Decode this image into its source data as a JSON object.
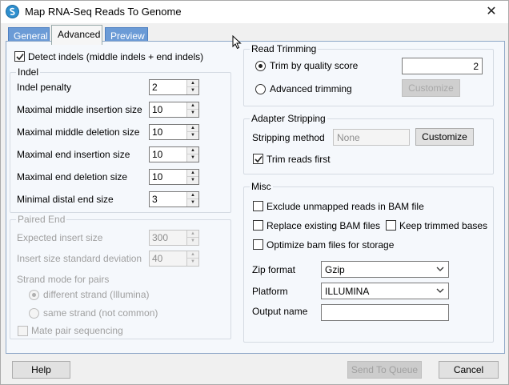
{
  "window": {
    "title": "Map RNA-Seq Reads To Genome",
    "close_symbol": "✕"
  },
  "tabs": [
    {
      "label": "General"
    },
    {
      "label": "Advanced"
    },
    {
      "label": "Preview"
    }
  ],
  "left": {
    "detect_indels": {
      "label": "Detect indels (middle indels + end indels)",
      "checked": true
    },
    "indel_group": {
      "legend": "Indel",
      "fields": [
        {
          "label": "Indel penalty",
          "value": "2"
        },
        {
          "label": "Maximal middle insertion size",
          "value": "10"
        },
        {
          "label": "Maximal middle deletion size",
          "value": "10"
        },
        {
          "label": "Maximal end insertion size",
          "value": "10"
        },
        {
          "label": "Maximal end deletion size",
          "value": "10"
        },
        {
          "label": "Minimal distal end size",
          "value": "3"
        }
      ]
    },
    "paired_group": {
      "legend": "Paired End",
      "expected_insert": {
        "label": "Expected insert size",
        "value": "300"
      },
      "insert_std": {
        "label": "Insert size standard deviation",
        "value": "40"
      },
      "strand_mode_label": "Strand mode for pairs",
      "strand_options": [
        {
          "label": "different strand (Illumina)",
          "selected": true
        },
        {
          "label": "same strand (not common)",
          "selected": false
        }
      ],
      "mate_pair": {
        "label": "Mate pair sequencing",
        "checked": false
      }
    }
  },
  "right": {
    "read_trimming": {
      "legend": "Read Trimming",
      "by_quality": {
        "label": "Trim by quality score",
        "selected": true,
        "value": "2"
      },
      "advanced": {
        "label": "Advanced trimming",
        "selected": false
      },
      "customize_label": "Customize"
    },
    "adapter": {
      "legend": "Adapter Stripping",
      "method_label": "Stripping method",
      "method_value": "None",
      "customize_label": "Customize",
      "trim_first": {
        "label": "Trim reads first",
        "checked": true
      }
    },
    "misc": {
      "legend": "Misc",
      "exclude_unmapped": {
        "label": "Exclude unmapped reads in BAM file",
        "checked": false
      },
      "replace_bam": {
        "label": "Replace existing BAM files",
        "checked": false
      },
      "keep_trimmed": {
        "label": "Keep trimmed bases",
        "checked": false
      },
      "optimize_bam": {
        "label": "Optimize bam files for storage",
        "checked": false
      },
      "zip_label": "Zip format",
      "zip_value": "Gzip",
      "platform_label": "Platform",
      "platform_value": "ILLUMINA",
      "output_label": "Output name",
      "output_value": ""
    }
  },
  "footer": {
    "help": "Help",
    "send_to_queue": "Send To Queue",
    "cancel": "Cancel"
  }
}
